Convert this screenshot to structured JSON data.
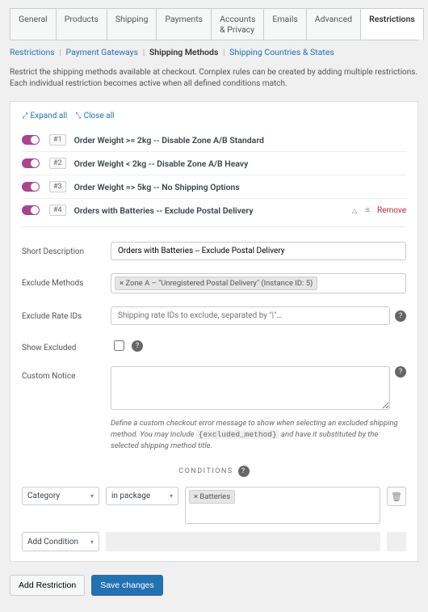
{
  "tabs": [
    "General",
    "Products",
    "Shipping",
    "Payments",
    "Accounts & Privacy",
    "Emails",
    "Advanced",
    "Restrictions"
  ],
  "active_tab": 7,
  "subtabs": [
    "Restrictions",
    "Payment Gateways",
    "Shipping Methods",
    "Shipping Countries & States"
  ],
  "active_subtab": 2,
  "page_description": "Restrict the shipping methods available at checkout. Complex rules can be created by adding multiple restrictions. Each individual restriction becomes active when all defined conditions match.",
  "expand_all": "Expand all",
  "close_all": "Close all",
  "rules": [
    {
      "num": "#1",
      "title": "Order Weight >= 2kg -- Disable Zone A/B Standard"
    },
    {
      "num": "#2",
      "title": "Order Weight < 2kg -- Disable Zone A/B Heavy"
    },
    {
      "num": "#3",
      "title": "Order Weight => 5kg -- No Shipping Options"
    },
    {
      "num": "#4",
      "title": "Orders with Batteries -- Exclude Postal Delivery"
    }
  ],
  "rule_actions": {
    "remove": "Remove"
  },
  "form": {
    "labels": {
      "short_desc": "Short Description",
      "exclude_methods": "Exclude Methods",
      "exclude_rate_ids": "Exclude Rate IDs",
      "show_excluded": "Show Excluded",
      "custom_notice": "Custom Notice"
    },
    "short_desc_value": "Orders with Batteries -- Exclude Postal Delivery",
    "exclude_methods_tag": "× Zone A – \"Unregistered Postal Delivery\" (Instance ID: 5)",
    "rate_ids_placeholder": "Shipping rate IDs to exclude, separated by \"|\"…",
    "notice_help_1": "Define a custom checkout error message to show when selecting an excluded shipping method. You may include ",
    "notice_help_code": "{excluded_method}",
    "notice_help_2": " and have it substituted by the selected shipping method title.",
    "conditions_header": "CONDITIONS",
    "condition": {
      "type": "Category",
      "scope": "in package",
      "value_tag": "× Batteries"
    },
    "add_condition": "Add Condition"
  },
  "buttons": {
    "add_restriction": "Add Restriction",
    "save_changes": "Save changes"
  }
}
